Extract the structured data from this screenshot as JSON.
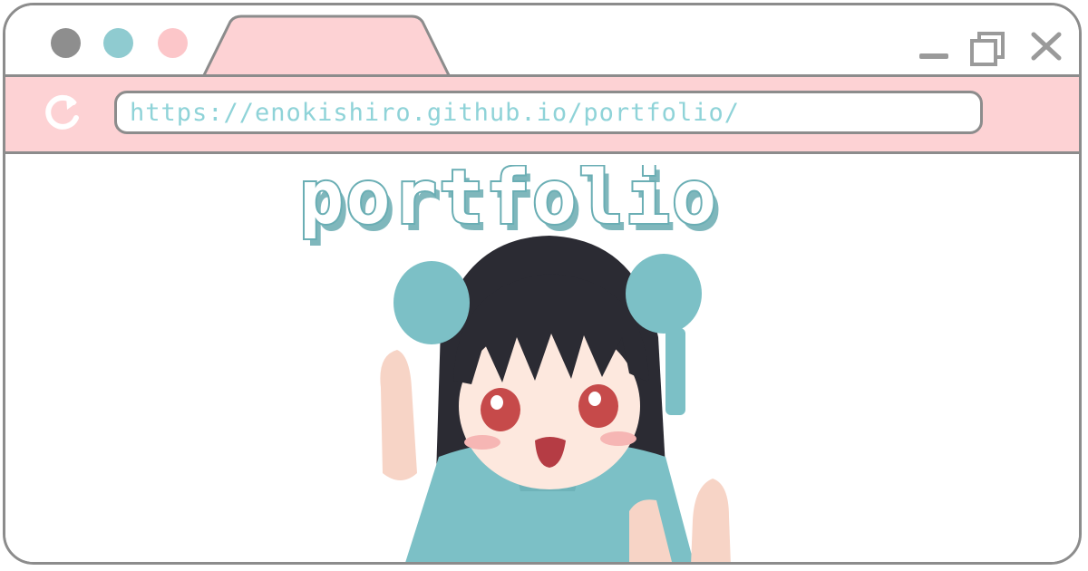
{
  "window": {
    "traffic_lights": [
      {
        "name": "gray-dot",
        "color": "#8e8e8e"
      },
      {
        "name": "teal-dot",
        "color": "#8fcbd0"
      },
      {
        "name": "pink-dot",
        "color": "#fcc6c9"
      }
    ],
    "controls": [
      "minimize-icon",
      "maximize-icon",
      "close-icon"
    ]
  },
  "toolbar": {
    "reload_icon": "reload-icon",
    "url": "https://enokishiro.github.io/portfolio/"
  },
  "content": {
    "heading": "portfolio",
    "illustration": "anime-girl-illustration"
  },
  "colors": {
    "accent_pink": "#fdd2d4",
    "accent_teal": "#8fd3d8",
    "border": "#8c8c8c"
  }
}
